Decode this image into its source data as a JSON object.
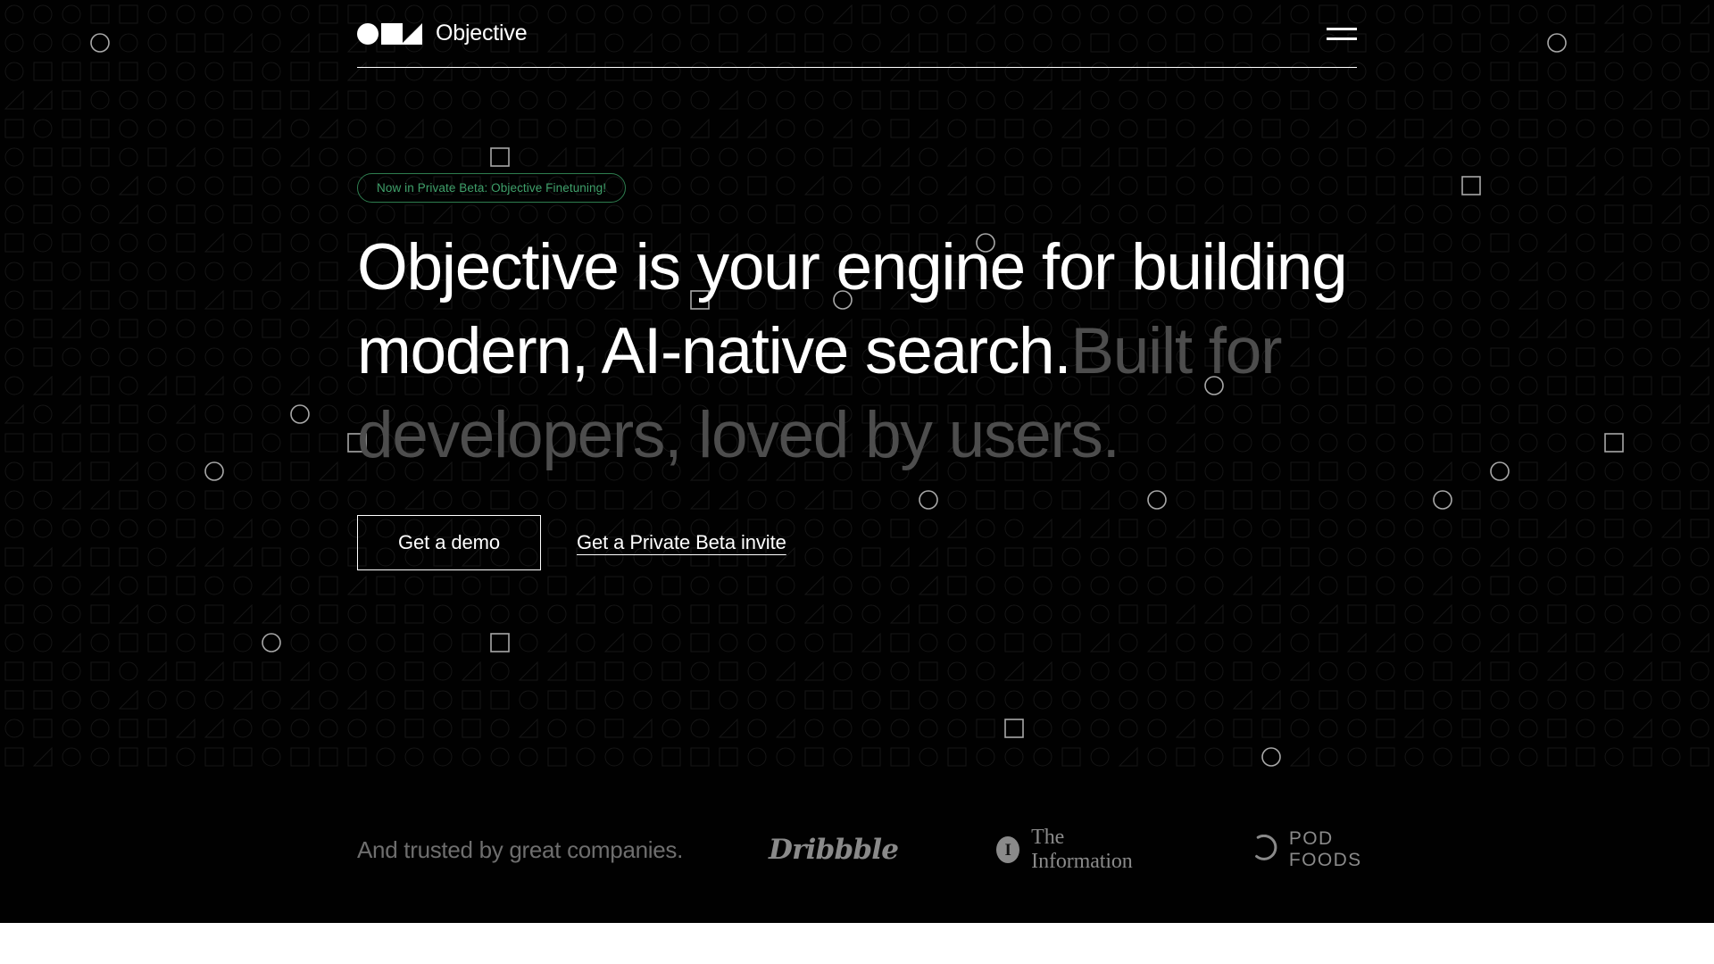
{
  "theme": {
    "background": "#010101",
    "page_background": "#ffffff",
    "text_primary": "#ffffff",
    "text_dim": "#4d4d4d",
    "text_dimmer": "#333333",
    "accent_green": "#3fa06a",
    "accent_green_border": "#2e7d4f",
    "logo_gray": "#8a8a8a",
    "trusted_label_gray": "#6e6e6e"
  },
  "nav": {
    "brand_name": "Objective",
    "logo_icon": "objective-mark-circle-square-triangle",
    "menu_icon": "hamburger-menu-icon"
  },
  "hero": {
    "badge": "Now in Private Beta: Objective Finetuning!",
    "headline_segments": [
      {
        "text": "Objective is your engine for building modern, AI-native search.",
        "tone": "bright"
      },
      {
        "text": "Built for developers, loved by users.",
        "tone": "dim"
      }
    ],
    "headline_part_1": "Objective is your engine for building modern, AI-native search.",
    "headline_part_2": "Built for developers, loved by users.",
    "cta_primary": "Get a demo",
    "cta_secondary": "Get a Private Beta invite"
  },
  "trusted": {
    "label": "And trusted by great companies.",
    "logos": [
      {
        "name": "Dribbble",
        "icon": "dribbble-wordmark"
      },
      {
        "name": "The Information",
        "icon": "the-information-i-icon",
        "glyph": "I"
      },
      {
        "name": "POD FOODS",
        "icon": "pod-foods-arc-icon"
      }
    ]
  }
}
